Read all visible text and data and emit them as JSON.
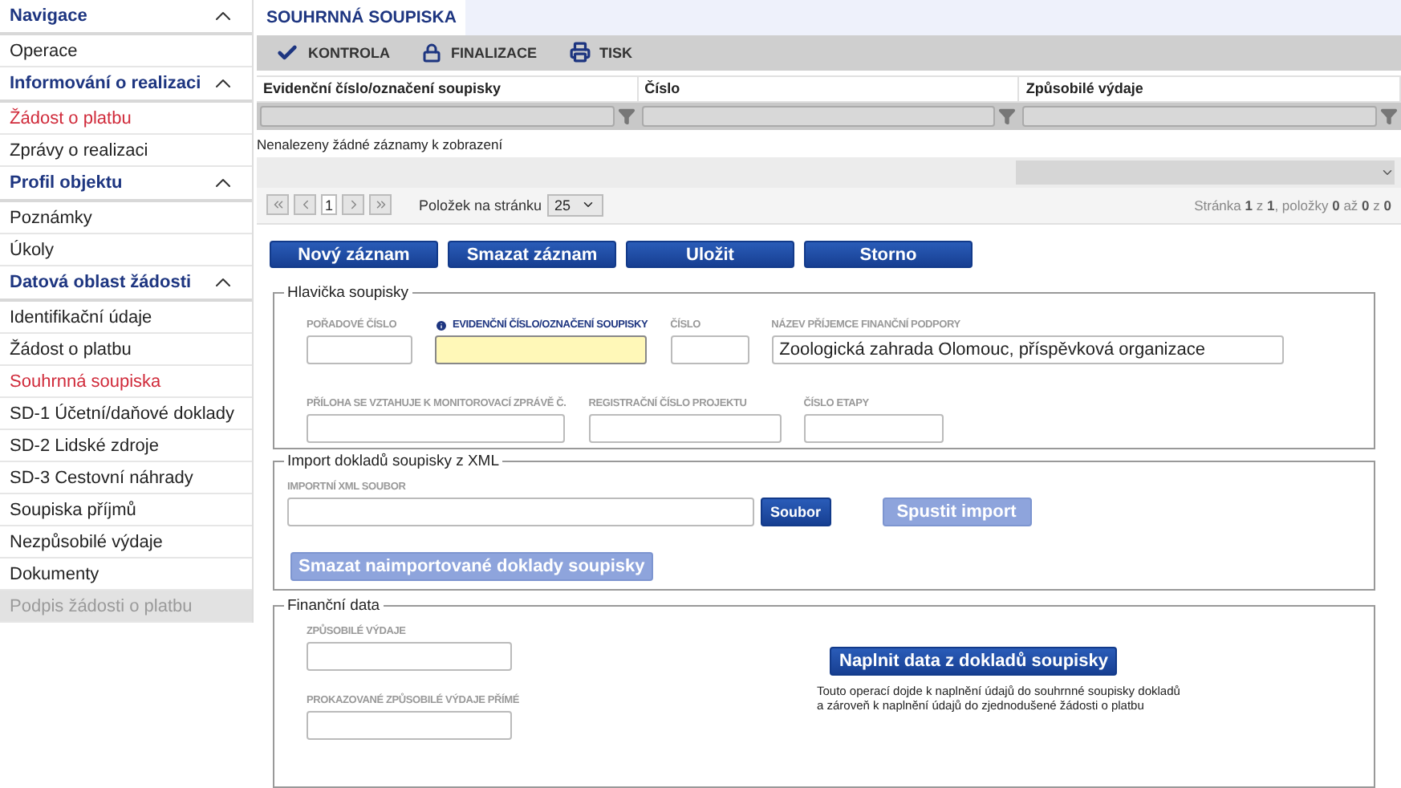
{
  "sidebar": {
    "groups": [
      {
        "title": "Navigace",
        "expanded": true,
        "items": [
          {
            "label": "Operace",
            "selected": false,
            "disabled": false
          }
        ]
      },
      {
        "title": "Informování o realizaci",
        "expanded": true,
        "items": [
          {
            "label": "Žádost o platbu",
            "selected": true,
            "disabled": false
          },
          {
            "label": "Zprávy o realizaci",
            "selected": false,
            "disabled": false
          }
        ]
      },
      {
        "title": "Profil objektu",
        "expanded": true,
        "items": [
          {
            "label": "Poznámky",
            "selected": false,
            "disabled": false
          },
          {
            "label": "Úkoly",
            "selected": false,
            "disabled": false
          }
        ]
      },
      {
        "title": "Datová oblast žádosti",
        "expanded": true,
        "items": [
          {
            "label": "Identifikační údaje",
            "selected": false,
            "disabled": false
          },
          {
            "label": "Žádost o platbu",
            "selected": false,
            "disabled": false
          },
          {
            "label": "Souhrnná soupiska",
            "selected": true,
            "disabled": false
          },
          {
            "label": "SD-1 Účetní/daňové doklady",
            "selected": false,
            "disabled": false
          },
          {
            "label": "SD-2 Lidské zdroje",
            "selected": false,
            "disabled": false
          },
          {
            "label": "SD-3 Cestovní náhrady",
            "selected": false,
            "disabled": false
          },
          {
            "label": "Soupiska příjmů",
            "selected": false,
            "disabled": false
          },
          {
            "label": "Nezpůsobilé výdaje",
            "selected": false,
            "disabled": false
          },
          {
            "label": "Dokumenty",
            "selected": false,
            "disabled": false
          },
          {
            "label": "Podpis žádosti o platbu",
            "selected": false,
            "disabled": true
          }
        ]
      }
    ]
  },
  "tabs": [
    {
      "label": "SOUHRNNÁ SOUPISKA",
      "selected": true
    }
  ],
  "toolbar": [
    {
      "kind": "check",
      "label": "KONTROLA"
    },
    {
      "kind": "lock",
      "label": "FINALIZACE"
    },
    {
      "kind": "print",
      "label": "TISK"
    }
  ],
  "table": {
    "columns": [
      "Evidenční číslo/označení soupisky",
      "Číslo",
      "Způsobilé výdaje"
    ],
    "empty_message": "Nenalezeny žádné záznamy k zobrazení"
  },
  "pager": {
    "page": "1",
    "page_size_label": "Položek na stránku",
    "page_size": "25",
    "summary": "Stránka **1** z **1**, položky **0** až **0** z **0**"
  },
  "actions": [
    "Nový záznam",
    "Smazat záznam",
    "Uložit",
    "Storno"
  ],
  "header_section": {
    "legend": "Hlavička soupisky",
    "fields": [
      {
        "label": "POŘADOVÉ ČÍSLO",
        "required": false
      },
      {
        "label": "EVIDENČNÍ ČÍSLO/OZNAČENÍ SOUPISKY",
        "required": true
      },
      {
        "label": "ČÍSLO",
        "required": false
      },
      {
        "label": "NÁZEV PŘÍJEMCE FINANČNÍ PODPORY",
        "required": false,
        "value": "Zoologická zahrada Olomouc,  příspěvková organizace"
      },
      {
        "label": "PŘÍLOHA SE VZTAHUJE K MONITOROVACÍ ZPRÁVĚ Č.",
        "required": false
      },
      {
        "label": "REGISTRAČNÍ ČÍSLO PROJEKTU",
        "required": false
      },
      {
        "label": "ČÍSLO ETAPY",
        "required": false
      }
    ]
  },
  "import_section": {
    "legend": "Import dokladů soupisky z XML",
    "file_label": "IMPORTNÍ XML SOUBOR",
    "file_button": "Soubor",
    "run_button": {
      "label": "Spustit import",
      "disabled": true
    },
    "delete_button": {
      "label": "Smazat naimportované doklady soupisky",
      "disabled": true
    }
  },
  "finance_section": {
    "legend": "Finanční data",
    "fields": [
      {
        "label": "ZPŮSOBILÉ VÝDAJE"
      },
      {
        "label": "PROKAZOVANÉ ZPŮSOBILÉ VÝDAJE PŘÍMÉ"
      }
    ],
    "fill_button": "Naplnit data z dokladů soupisky",
    "note": "Touto operací dojde k naplnění údajů do souhrnné soupisky dokladů a zároveň k naplnění údajů do zjednodušené žádosti o platbu"
  }
}
